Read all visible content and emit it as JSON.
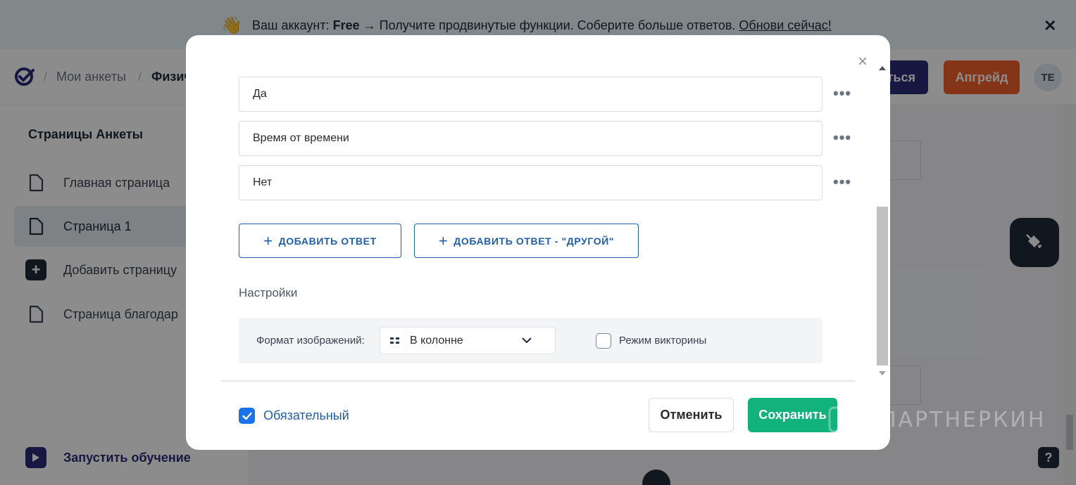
{
  "banner": {
    "prefix": "Ваш аккаунт: ",
    "plan": "Free",
    "middle": " → Получите продвинутые функции. Соберите больше ответов. ",
    "link": "Обнови сейчас!",
    "close_glyph": "✕",
    "emoji": "👋"
  },
  "topbar": {
    "breadcrumb": [
      "Мои анкеты",
      "Физич"
    ],
    "separator": "/",
    "publish_label": "ться",
    "upgrade_label": "Апгрейд",
    "avatar_initials": "TE"
  },
  "sidebar": {
    "title": "Страницы Анкеты",
    "items": [
      {
        "label": "Главная страница",
        "icon": "page-icon"
      },
      {
        "label": "Страница 1",
        "icon": "page-icon"
      },
      {
        "label": "Добавить страницу",
        "icon": "plus-icon"
      },
      {
        "label": "Страница благодар",
        "icon": "page-icon"
      }
    ],
    "learn_label": "Запустить обучение"
  },
  "modal": {
    "close_glyph": "×",
    "answers": [
      "Да",
      "Время от времени",
      "Нет"
    ],
    "more_glyph": "•••",
    "add_answer": "ДОБАВИТЬ ОТВЕТ",
    "add_other": "ДОБАВИТЬ ОТВЕТ - \"ДРУГОЙ\"",
    "settings_title": "Настройки",
    "image_format_label": "Формат изображений:",
    "image_format_value": "В колонне",
    "quiz_label": "Режим викторины",
    "quiz_checked": false,
    "required_label": "Обязательный",
    "required_checked": true,
    "cancel_label": "Отменить",
    "save_label": "Сохранить"
  },
  "help_glyph": "?",
  "watermark": "ПАРТНЕРКИН",
  "colors": {
    "primary_blue": "#1f5ea8",
    "save_green": "#11b27c",
    "upgrade_orange": "#f0612d",
    "publish_navy": "#2b2a77",
    "checkbox_blue": "#1a73e8"
  }
}
